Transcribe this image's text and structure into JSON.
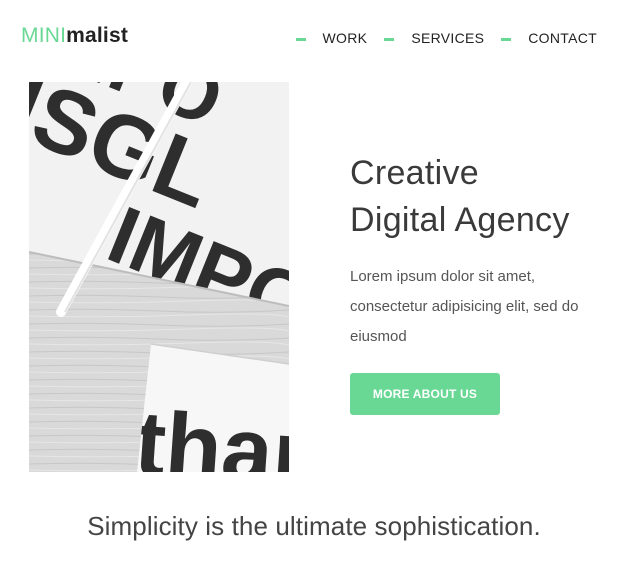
{
  "header": {
    "logo_accent": "MINI",
    "logo_rest": "malist",
    "nav": [
      {
        "label": "WORK"
      },
      {
        "label": "SERVICES"
      },
      {
        "label": "CONTACT"
      }
    ]
  },
  "hero": {
    "headline_line1": "Creative",
    "headline_line2": "Digital Agency",
    "lead": "Lorem ipsum dolor sit amet, consectetur adipisicing elit, sed do eiusmod",
    "cta_label": "MORE ABOUT US"
  },
  "tagline": "Simplicity is the ultimate sophistication.",
  "colors": {
    "accent": "#6ad895",
    "text_dark": "#222222",
    "text_body": "#555555"
  }
}
